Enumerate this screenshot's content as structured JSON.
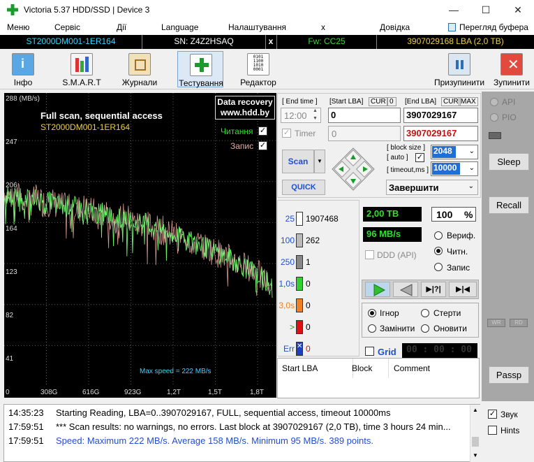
{
  "window": {
    "title": "Victoria 5.37 HDD/SSD | Device 3"
  },
  "menu": {
    "items": [
      "Меню",
      "Сервіс",
      "Дії",
      "Language",
      "Налаштування",
      "x",
      "Довідка"
    ],
    "buffer_view": "Перегляд буфера"
  },
  "info": {
    "model": "ST2000DM001-1ER164",
    "serial": "SN: Z4Z2HSAQ",
    "close": "x",
    "firmware": "Fw: CC25",
    "capacity": "3907029168 LBA (2,0 TB)"
  },
  "toolbar": {
    "info": "Інфо",
    "smart": "S.M.A.R.T",
    "logs": "Журнали",
    "testing": "Тестування",
    "editor": "Редактор",
    "pause": "Призупинити",
    "stop": "Зупинити"
  },
  "graph": {
    "unit": "288 (MB/s)",
    "title": "Full scan, sequential access",
    "model": "ST2000DM001-1ER164",
    "read_label": "Читання",
    "write_label": "Запис",
    "promo1": "Data recovery",
    "promo2": "www.hdd.by",
    "max_speed": "Max speed = 222 MB/s",
    "y_ticks": [
      "247",
      "206",
      "164",
      "123",
      "82",
      "41"
    ],
    "x_ticks": [
      "0",
      "308G",
      "616G",
      "923G",
      "1,2T",
      "1,5T",
      "1,8T"
    ]
  },
  "chart_data": {
    "type": "line",
    "ylim": [
      0,
      288
    ],
    "x_unit": "TB",
    "series": [
      {
        "name": "Читання",
        "x": [
          0.0,
          0.05,
          0.1,
          0.15,
          0.2,
          0.25,
          0.3,
          0.35,
          0.4,
          0.45,
          0.5,
          0.55,
          0.6,
          0.65,
          0.7,
          0.75,
          0.8,
          0.85,
          0.9,
          0.95,
          1.0,
          1.05,
          1.1,
          1.15,
          1.2,
          1.25,
          1.3,
          1.35,
          1.4,
          1.45,
          1.5,
          1.55,
          1.6,
          1.65,
          1.7,
          1.75,
          1.8,
          1.85,
          1.9,
          1.95,
          2.0
        ],
        "values": [
          195,
          190,
          192,
          188,
          186,
          189,
          184,
          186,
          182,
          180,
          183,
          178,
          180,
          176,
          173,
          175,
          170,
          168,
          171,
          166,
          163,
          165,
          160,
          158,
          156,
          153,
          150,
          152,
          146,
          143,
          140,
          137,
          134,
          131,
          127,
          124,
          120,
          116,
          112,
          106,
          98
        ]
      }
    ]
  },
  "controls": {
    "end_time_label": "[ End time ]",
    "start_lba_label": "[Start LBA]",
    "cur": "CUR",
    "zero": "0",
    "end_lba_label": "[End LBA]",
    "max": "MAX",
    "time_value": "12:00",
    "start_lba": "0",
    "end_lba": "3907029167",
    "timer_label": "Timer",
    "timer_value": "0",
    "end_lba2": "3907029167",
    "scan": "Scan",
    "quick": "QUICK",
    "block_size_label": "[ block size ]",
    "auto_label": "[ auto ]",
    "block_size": "2048",
    "timeout_label": "[ timeout,ms ]",
    "timeout": "10000",
    "finish_action": "Завершити"
  },
  "stats": {
    "rows": [
      {
        "label": "25",
        "value": "1907468"
      },
      {
        "label": "100",
        "value": "262"
      },
      {
        "label": "250",
        "value": "1"
      },
      {
        "label": "1,0s",
        "value": "0"
      },
      {
        "label": "3,0s",
        "value": "0"
      },
      {
        "label": ">",
        "value": "0"
      },
      {
        "label": "Err",
        "value": "0"
      }
    ],
    "position": "2,00 TB",
    "percent": "100",
    "percent_sign": "%",
    "speed": "96 MB/s",
    "ddd": "DDD (API)",
    "verify": "Вериф.",
    "read": "Читн.",
    "write": "Запис",
    "ignore": "Ігнор",
    "erase": "Стерти",
    "remap": "Замінити",
    "refresh": "Оновити",
    "grid": "Grid",
    "grid_time": "00 : 00 : 00",
    "col_start_lba": "Start LBA",
    "col_block": "Block",
    "col_comment": "Comment"
  },
  "side": {
    "api": "API",
    "pio": "PIO",
    "sleep": "Sleep",
    "recall": "Recall",
    "wr": "WR",
    "rd": "RD",
    "passp": "Passp"
  },
  "log": [
    {
      "time": "14:35:23",
      "text": "Starting Reading, LBA=0..3907029167, FULL, sequential access, timeout 10000ms",
      "color": "#000000"
    },
    {
      "time": "17:59:51",
      "text": "*** Scan results: no warnings, no errors. Last block at 3907029167 (2,0 TB), time 3 hours 24 min...",
      "color": "#000000"
    },
    {
      "time": "17:59:51",
      "text": "Speed: Maximum 222 MB/s. Average 158 MB/s. Minimum 95 MB/s. 389 points.",
      "color": "#1f4fd0"
    }
  ],
  "options": {
    "sound": "Звук",
    "hints": "Hints"
  }
}
